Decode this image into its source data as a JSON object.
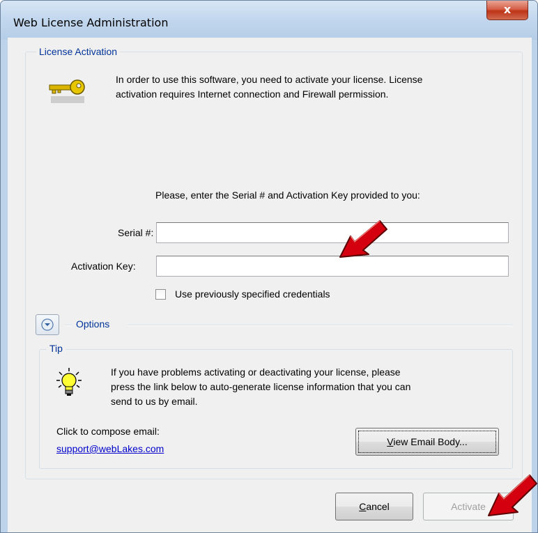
{
  "window": {
    "title": "Web License Administration",
    "close_label": "x"
  },
  "activation_group": {
    "legend": "License Activation",
    "intro_line1": "In order to use this software, you need to activate your license. License",
    "intro_line2": "activation requires Internet connection and Firewall permission.",
    "prompt": "Please, enter the Serial # and Activation Key provided to you:",
    "serial_label": "Serial #:",
    "serial_value": "",
    "activation_key_label": "Activation Key:",
    "activation_key_value": "",
    "use_previous_label": "Use previously specified credentials",
    "use_previous_checked": false
  },
  "options": {
    "label": "Options"
  },
  "tip_group": {
    "legend": "Tip",
    "text_line1": "If you have problems activating or deactivating your license, please",
    "text_line2": "press the link below to auto-generate license information that you can",
    "text_line3": "send to us by email.",
    "compose_label": "Click to compose email:",
    "email_link": "support@webLakes.com",
    "view_email_prefix": "V",
    "view_email_rest": "iew Email Body..."
  },
  "footer": {
    "cancel_prefix": "C",
    "cancel_rest": "ancel",
    "activate_label": "Activate"
  },
  "icons": {
    "key": "key-icon",
    "lightbulb": "lightbulb-icon",
    "options_toggle": "chevron-down-icon",
    "annotation_arrow": "red-arrow-icon"
  },
  "colors": {
    "legend_text": "#003399",
    "link": "#0000cc",
    "arrow": "#d4000f"
  }
}
